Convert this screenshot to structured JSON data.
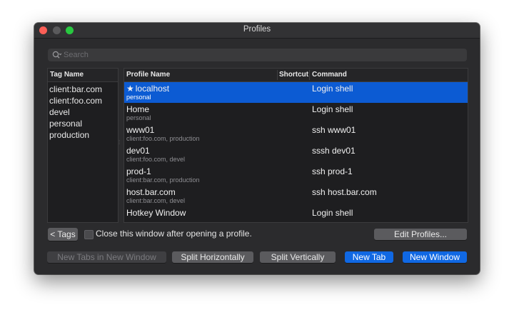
{
  "window": {
    "title": "Profiles"
  },
  "search": {
    "placeholder": "Search"
  },
  "tags": {
    "header": "Tag Name",
    "items": [
      "client:bar.com",
      "client:foo.com",
      "devel",
      "personal",
      "production"
    ]
  },
  "profiles": {
    "columns": {
      "name": "Profile Name",
      "shortcut": "Shortcut",
      "command": "Command"
    },
    "rows": [
      {
        "name": "localhost",
        "tags": "personal",
        "command": "Login shell",
        "starred": true,
        "selected": true
      },
      {
        "name": "Home",
        "tags": "personal",
        "command": "Login shell"
      },
      {
        "name": "www01",
        "tags": "client:foo.com, production",
        "command": "ssh www01"
      },
      {
        "name": "dev01",
        "tags": "client:foo.com, devel",
        "command": "sssh dev01"
      },
      {
        "name": "prod-1",
        "tags": "client:bar.com, production",
        "command": "ssh prod-1"
      },
      {
        "name": "host.bar.com",
        "tags": "client:bar.com, devel",
        "command": "ssh host.bar.com"
      },
      {
        "name": "Hotkey Window",
        "tags": "",
        "command": "Login shell"
      }
    ]
  },
  "controls": {
    "tags_toggle": "< Tags",
    "close_after_open": "Close this window after opening a profile.",
    "edit_profiles": "Edit Profiles..."
  },
  "actions": {
    "new_tabs_in_new_window": "New Tabs in New Window",
    "split_horizontally": "Split Horizontally",
    "split_vertically": "Split Vertically",
    "new_tab": "New Tab",
    "new_window": "New Window"
  },
  "colors": {
    "selection": "#0c5bd3",
    "primary_button": "#1068e3",
    "window_bg": "#2b2b2d"
  }
}
